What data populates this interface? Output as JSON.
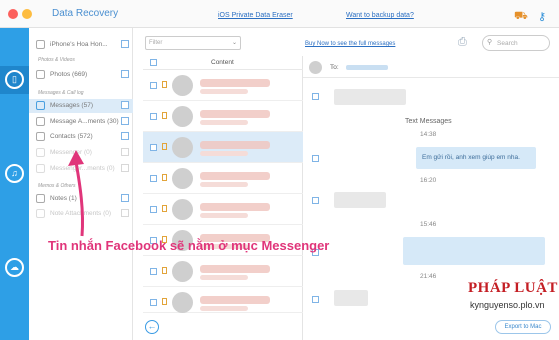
{
  "window": {
    "title": "Data Recovery",
    "link_eraser": "iOS Private Data Eraser",
    "link_backup": "Want to backup data?"
  },
  "toolbar": {
    "filter_placeholder": "Filter",
    "buy_now": "Buy Now to see the full messages",
    "search_placeholder": "Search"
  },
  "sidebar": {
    "device": "iPhone's Hoa Hon...",
    "sec_photos": "Photos & Videos",
    "photos": "Photos (669)",
    "sec_messages": "Messages & Call log",
    "messages": "Messages (57)",
    "message_attachments": "Message A...ments (30)",
    "contacts": "Contacts (572)",
    "messenger": "Messenger (0)",
    "messenger_attachments": "Messenger...ments (0)",
    "sec_memos": "Memos & Others",
    "notes": "Notes (1)",
    "note_attachments": "Note Attachments (0)"
  },
  "list": {
    "header": "Content"
  },
  "detail": {
    "to_label": "To:",
    "conversation_title": "Text Messages",
    "time1": "14:38",
    "time2": "16:20",
    "time3": "15:46",
    "time4": "21:46",
    "outgoing_message": "Em gửi rồi, anh xem giúp em nha."
  },
  "footer": {
    "export": "Export to Mac"
  },
  "annotation": {
    "callout": "Tin nhắn Facebook sẽ nằm ở mục Messenger"
  },
  "watermark": {
    "brand": "PHÁP LUẬT",
    "site": "kynguyenso.plo.vn"
  },
  "colors": {
    "accent": "#2e9fe6",
    "callout": "#e0357a",
    "brand": "#c41e24"
  }
}
